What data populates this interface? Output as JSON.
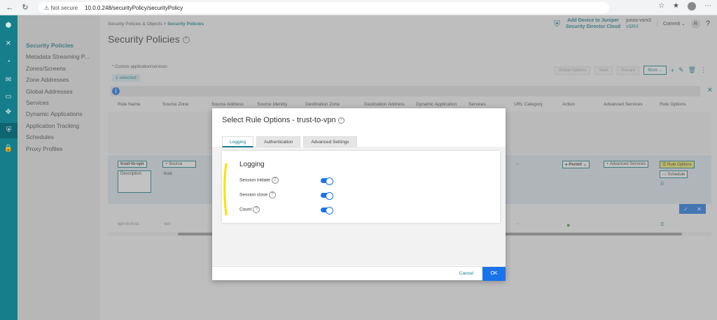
{
  "browser": {
    "security_label": "Not secure",
    "url": "10.0.0.248/securityPolicy/securityPolicy"
  },
  "sidenav": {
    "items": [
      {
        "label": "Security Policies"
      },
      {
        "label": "Metadata Streaming P..."
      },
      {
        "label": "Zones/Screens"
      },
      {
        "label": "Zone Addresses"
      },
      {
        "label": "Global Addresses"
      },
      {
        "label": "Services"
      },
      {
        "label": "Dynamic Applications"
      },
      {
        "label": "Application Tracking"
      },
      {
        "label": "Schedules"
      },
      {
        "label": "Proxy Profiles"
      }
    ]
  },
  "header": {
    "breadcrumb_parent": "Security Policies & Objects",
    "breadcrumb_sep": ">",
    "breadcrumb_current": "Security Policies",
    "title": "Security Policies",
    "add_device_line1": "Add Device to Juniper",
    "add_device_line2": "Security Director Cloud",
    "device_name": "junos-vsrx3",
    "device_type": "vSRX",
    "commit_label": "Commit",
    "user_initial": "R"
  },
  "table": {
    "custom_note": "* Custom application/services",
    "selected_label": "1 selected",
    "global_options": "Global Options",
    "save": "Save",
    "discard": "Discard",
    "more": "More",
    "columns": [
      "Rule Name",
      "Source Zone",
      "Source Address",
      "Source Identity",
      "Destination Zone",
      "Destination Address",
      "Dynamic Application",
      "Services",
      "URL Category",
      "Action",
      "Advanced Services",
      "Rule Options"
    ],
    "edit_row": {
      "name": "trust-to-vpn",
      "description_placeholder": "Description",
      "source_btn": "Source",
      "source_zone": "trust",
      "url_dash": "--",
      "action": "Permit",
      "advanced": "Advanced Services",
      "rule_options": "Rule Options",
      "schedule": "Schedule"
    },
    "last_row": {
      "name": "vpn-to-trust",
      "zone": "vpn",
      "url_dash": "--"
    }
  },
  "modal": {
    "title": "Select Rule Options - trust-to-vpn",
    "tabs": [
      "Logging",
      "Authentication",
      "Advanced Settings"
    ],
    "section_title": "Logging",
    "options": [
      {
        "label": "Session initiate",
        "enabled": true
      },
      {
        "label": "Session close",
        "enabled": true
      },
      {
        "label": "Count",
        "enabled": true
      }
    ],
    "cancel": "Cancel",
    "ok": "OK"
  }
}
